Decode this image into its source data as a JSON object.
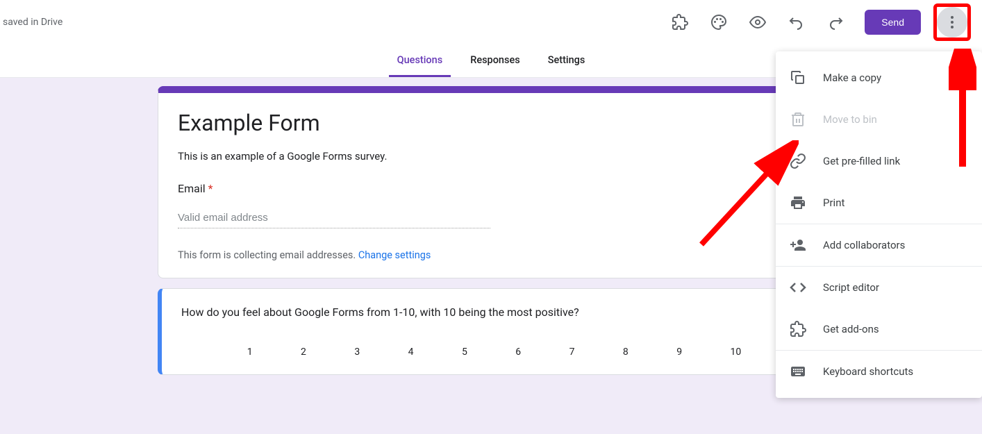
{
  "header": {
    "save_status": "saved in Drive",
    "send_label": "Send"
  },
  "tabs": {
    "questions": "Questions",
    "responses": "Responses",
    "settings": "Settings"
  },
  "form": {
    "title": "Example Form",
    "description": "This is an example of a Google Forms survey.",
    "email_label": "Email",
    "required_marker": "*",
    "email_placeholder": "Valid email address",
    "collect_note": "This form is collecting email addresses.  ",
    "change_settings_link": "Change settings"
  },
  "question": {
    "text": "How do you feel about Google Forms from 1-10, with 10 being the most positive?",
    "scale": [
      "1",
      "2",
      "3",
      "4",
      "5",
      "6",
      "7",
      "8",
      "9",
      "10"
    ]
  },
  "menu": {
    "make_copy": "Make a copy",
    "move_to_bin": "Move to bin",
    "prefilled_link": "Get pre-filled link",
    "print": "Print",
    "add_collaborators": "Add collaborators",
    "script_editor": "Script editor",
    "get_addons": "Get add-ons",
    "keyboard_shortcuts": "Keyboard shortcuts"
  }
}
